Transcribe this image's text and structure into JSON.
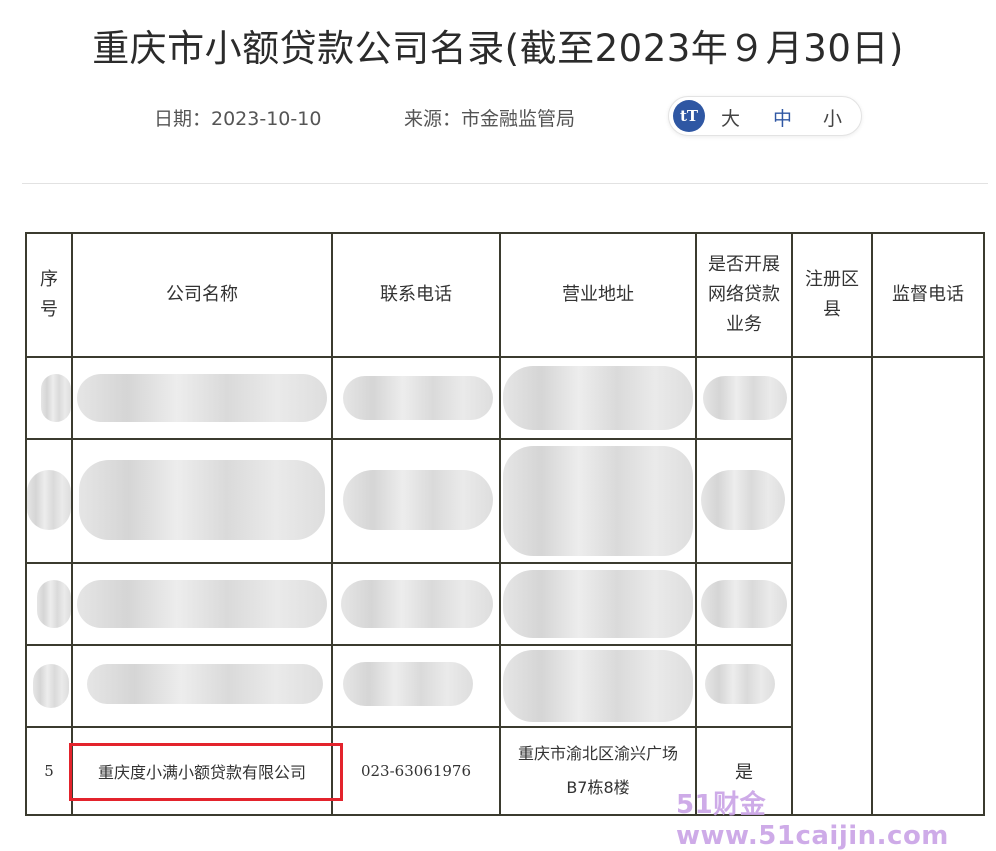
{
  "page": {
    "title": "重庆市小额贷款公司名录(截至2023年９月30日)",
    "date": "日期：2023-10-10",
    "source": "来源：市金融监管局",
    "font_size": {
      "icon": "tT",
      "large": "大",
      "medium": "中",
      "small": "小"
    }
  },
  "table": {
    "headers": {
      "seq": "序号",
      "company": "公司名称",
      "phone": "联系电话",
      "address": "营业地址",
      "online": "是否开展网络贷款业务",
      "district": "注册区县",
      "supervision_phone": "监督电话"
    },
    "rows": [
      {
        "seq": "5",
        "company": "重庆度小满小额贷款有限公司",
        "phone": "023-63061976",
        "address_line1": "重庆市渝北区渝兴广场",
        "address_line2": "B7栋8楼",
        "online": "是"
      }
    ]
  },
  "watermark": "51财金www.51caijin.com",
  "colors": {
    "highlight": "#e3232c",
    "accent": "#2f57a3",
    "border": "#3b3b2f"
  }
}
